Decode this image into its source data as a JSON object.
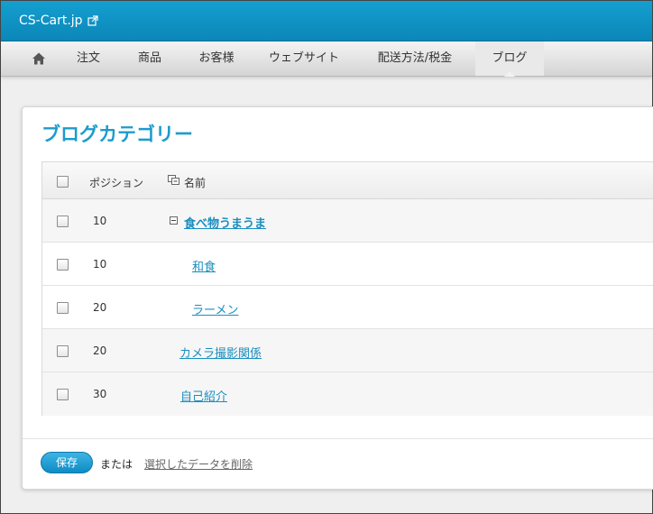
{
  "header": {
    "site_name": "CS-Cart.jp"
  },
  "nav": {
    "home_icon": "home-icon",
    "items": [
      "注文",
      "商品",
      "お客様",
      "ウェブサイト",
      "配送方法/税金",
      "ブログ"
    ],
    "active": "ブログ"
  },
  "page": {
    "title": "ブログカテゴリー",
    "columns": {
      "position": "ポジション",
      "name": "名前"
    },
    "rows": [
      {
        "position": "10",
        "name": "食べ物うまうま"
      },
      {
        "position": "10",
        "name": "和食"
      },
      {
        "position": "20",
        "name": "ラーメン"
      },
      {
        "position": "20",
        "name": "カメラ撮影関係"
      },
      {
        "position": "30",
        "name": "自己紹介"
      }
    ]
  },
  "footer": {
    "save_label": "保存",
    "or_text": "または",
    "delete_label": "選択したデータを削除"
  },
  "colors": {
    "brand": "#1c9ccd",
    "topbar": "#0b87b8",
    "link": "#1a8ec0"
  }
}
